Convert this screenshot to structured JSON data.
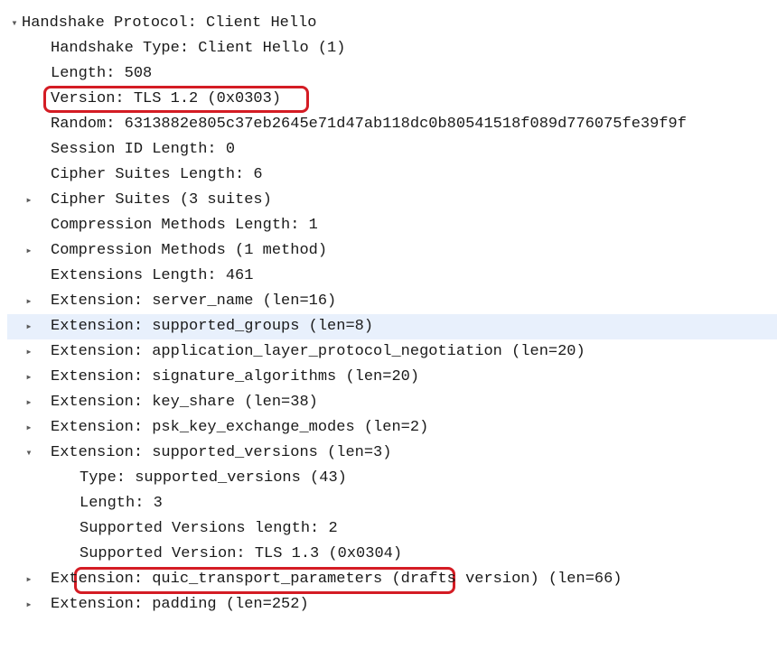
{
  "protocol_analyzer": {
    "root": "Handshake Protocol: Client Hello",
    "fields": {
      "handshake_type": "Handshake Type: Client Hello (1)",
      "length": "Length: 508",
      "version": "Version: TLS 1.2 (0x0303)",
      "random": "Random: 6313882e805c37eb2645e71d47ab118dc0b80541518f089d776075fe39f9f",
      "session_id_length": "Session ID Length: 0",
      "cipher_suites_length": "Cipher Suites Length: 6",
      "cipher_suites": "Cipher Suites (3 suites)",
      "compression_methods_length": "Compression Methods Length: 1",
      "compression_methods": "Compression Methods (1 method)",
      "extensions_length": "Extensions Length: 461",
      "ext_server_name": "Extension: server_name (len=16)",
      "ext_supported_groups": "Extension: supported_groups (len=8)",
      "ext_alpn": "Extension: application_layer_protocol_negotiation (len=20)",
      "ext_sig_algs": "Extension: signature_algorithms (len=20)",
      "ext_key_share": "Extension: key_share (len=38)",
      "ext_psk_modes": "Extension: psk_key_exchange_modes (len=2)",
      "ext_supported_versions": "Extension: supported_versions (len=3)",
      "sv": {
        "type": "Type: supported_versions (43)",
        "length": "Length: 3",
        "list_len": "Supported Versions length: 2",
        "version": "Supported Version: TLS 1.3 (0x0304)"
      },
      "ext_quic": "Extension: quic_transport_parameters (drafts version) (len=66)",
      "ext_padding": "Extension: padding (len=252)"
    },
    "highlighted_fields": [
      "version",
      "sv.version"
    ],
    "selected_row": "ext_supported_groups"
  }
}
